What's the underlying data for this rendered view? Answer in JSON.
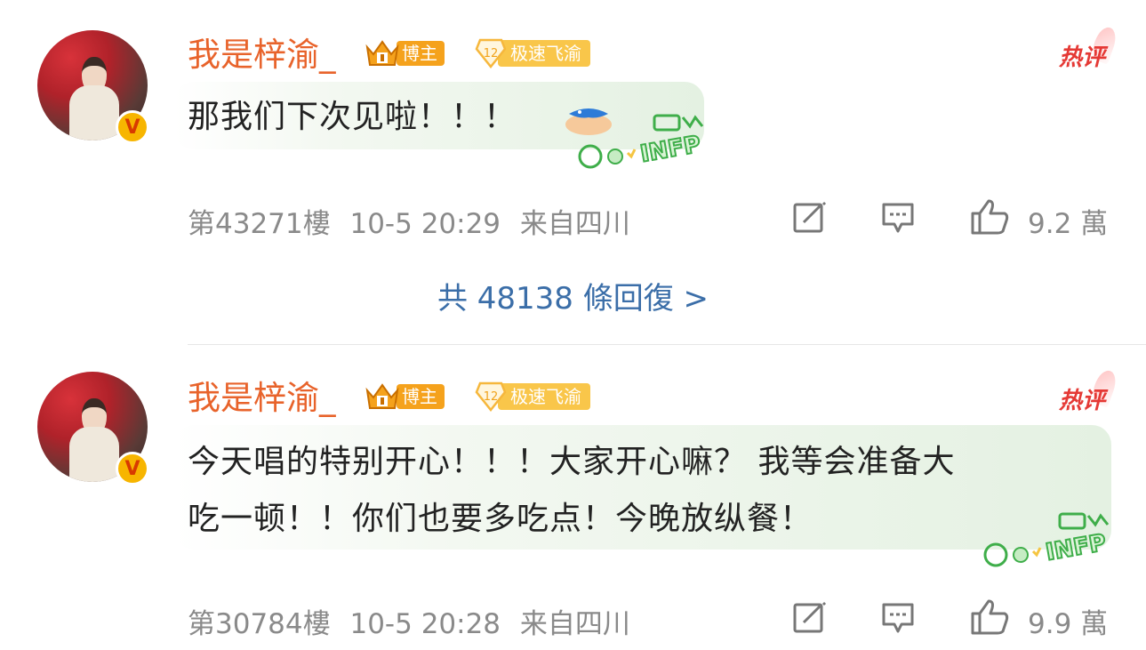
{
  "comments": [
    {
      "username": "我是梓渝_",
      "host_badge": "博主",
      "fan_level": "12",
      "fan_badge": "极速飞渝",
      "hot_label": "热评",
      "text_lines": [
        "那我们下次见啦！！！"
      ],
      "floor": "第43271樓",
      "time": "10-5 20:29",
      "location": "来自四川",
      "likes": "9.2 萬",
      "verified_mark": "V",
      "sticker": "INFP"
    },
    {
      "username": "我是梓渝_",
      "host_badge": "博主",
      "fan_level": "12",
      "fan_badge": "极速飞渝",
      "hot_label": "热评",
      "text_lines": [
        "今天唱的特别开心！！！大家开心嘛？ 我等会准备大",
        "吃一顿！！你们也要多吃点！今晚放纵餐！"
      ],
      "floor": "第30784樓",
      "time": "10-5 20:28",
      "location": "来自四川",
      "likes": "9.9 萬",
      "verified_mark": "V",
      "sticker": "INFP"
    }
  ],
  "replies_link": "共 48138 條回復 >",
  "icons": {
    "repost": "repost-icon",
    "comment": "comment-icon",
    "like": "thumbs-up-icon",
    "emoji": "hands-holding-fish-emoji"
  },
  "colors": {
    "username": "#e8632b",
    "hot": "#e53935",
    "link": "#3b6ea8",
    "meta": "#8a8a8a"
  }
}
